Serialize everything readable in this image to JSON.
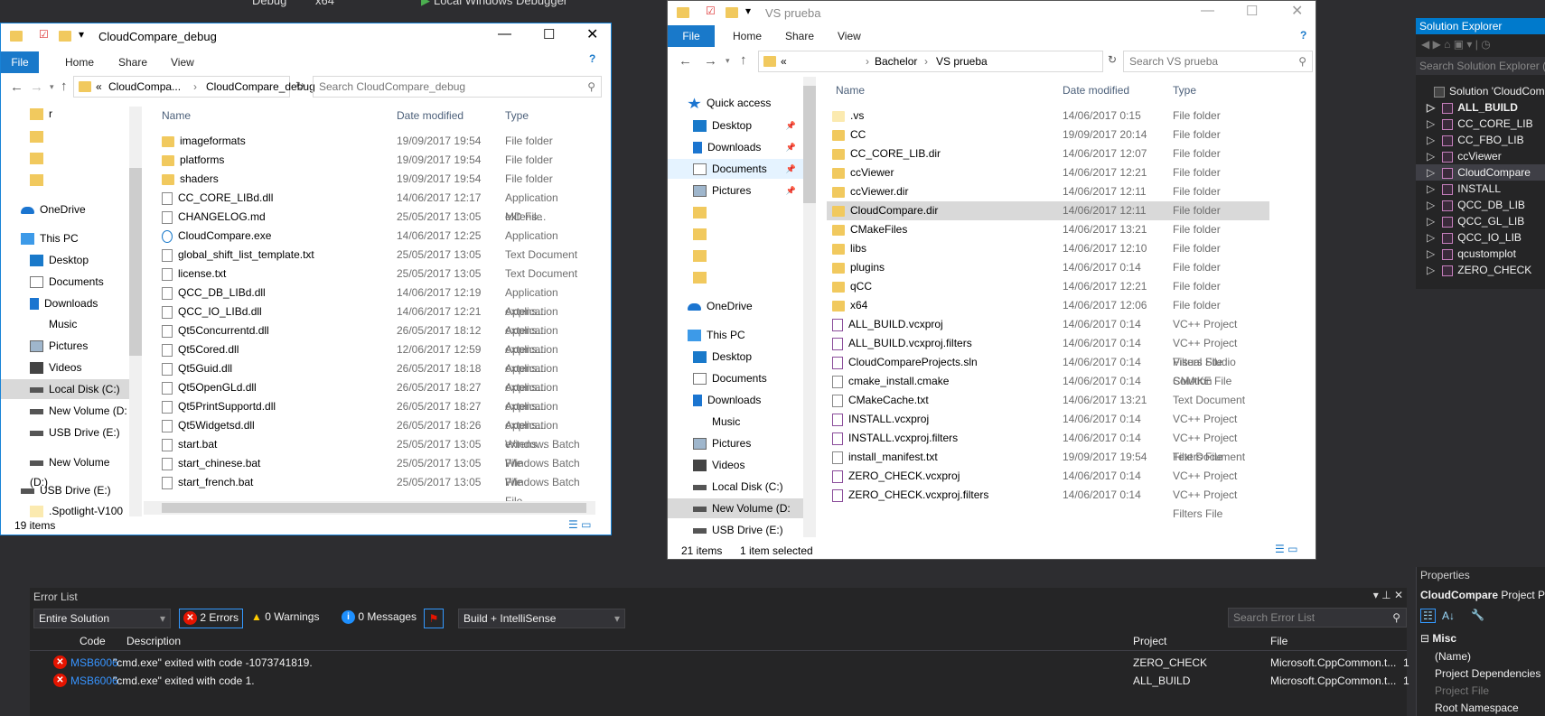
{
  "vs_toolbar": {
    "config": "Debug",
    "platform": "x64",
    "debugger": "Local Windows Debugger"
  },
  "left_window": {
    "title": "CloudCompare_debug",
    "ribbon": [
      "File",
      "Home",
      "Share",
      "View"
    ],
    "address": [
      "«",
      "CloudCompa...",
      "›",
      "CloudCompare_debug"
    ],
    "search_placeholder": "Search CloudCompare_debug",
    "columns": [
      "Name",
      "Date modified",
      "Type"
    ],
    "sidebar": [
      {
        "label": "r",
        "icon": "folder"
      },
      {
        "label": "",
        "icon": "folder"
      },
      {
        "label": "",
        "icon": "folder"
      },
      {
        "label": "",
        "icon": "folder"
      },
      {
        "label": "OneDrive",
        "icon": "onedrive"
      },
      {
        "label": "This PC",
        "icon": "pc"
      },
      {
        "label": "Desktop",
        "icon": "desktop"
      },
      {
        "label": "Documents",
        "icon": "documents"
      },
      {
        "label": "Downloads",
        "icon": "downloads"
      },
      {
        "label": "Music",
        "icon": "music"
      },
      {
        "label": "Pictures",
        "icon": "pictures"
      },
      {
        "label": "Videos",
        "icon": "videos"
      },
      {
        "label": "Local Disk (C:)",
        "icon": "drive",
        "selected": true
      },
      {
        "label": "New Volume (D:",
        "icon": "drive"
      },
      {
        "label": "USB Drive (E:)",
        "icon": "drive"
      },
      {
        "label": "New Volume (D:)",
        "icon": "drive"
      },
      {
        "label": "USB Drive (E:)",
        "icon": "drive"
      },
      {
        "label": ".Spotlight-V100",
        "icon": "folder-light"
      }
    ],
    "files": [
      {
        "name": "imageformats",
        "date": "19/09/2017 19:54",
        "type": "File folder",
        "icon": "folder"
      },
      {
        "name": "platforms",
        "date": "19/09/2017 19:54",
        "type": "File folder",
        "icon": "folder"
      },
      {
        "name": "shaders",
        "date": "19/09/2017 19:54",
        "type": "File folder",
        "icon": "folder"
      },
      {
        "name": "CC_CORE_LIBd.dll",
        "date": "14/06/2017 12:17",
        "type": "Application extens...",
        "icon": "dll"
      },
      {
        "name": "CHANGELOG.md",
        "date": "25/05/2017 13:05",
        "type": "MD File",
        "icon": "file"
      },
      {
        "name": "CloudCompare.exe",
        "date": "14/06/2017 12:25",
        "type": "Application",
        "icon": "exe"
      },
      {
        "name": "global_shift_list_template.txt",
        "date": "25/05/2017 13:05",
        "type": "Text Document",
        "icon": "file"
      },
      {
        "name": "license.txt",
        "date": "25/05/2017 13:05",
        "type": "Text Document",
        "icon": "file"
      },
      {
        "name": "QCC_DB_LIBd.dll",
        "date": "14/06/2017 12:19",
        "type": "Application extens...",
        "icon": "dll"
      },
      {
        "name": "QCC_IO_LIBd.dll",
        "date": "14/06/2017 12:21",
        "type": "Application extens...",
        "icon": "dll"
      },
      {
        "name": "Qt5Concurrentd.dll",
        "date": "26/05/2017 18:12",
        "type": "Application extens...",
        "icon": "dll"
      },
      {
        "name": "Qt5Cored.dll",
        "date": "12/06/2017 12:59",
        "type": "Application extens...",
        "icon": "dll"
      },
      {
        "name": "Qt5Guid.dll",
        "date": "26/05/2017 18:18",
        "type": "Application extens...",
        "icon": "dll"
      },
      {
        "name": "Qt5OpenGLd.dll",
        "date": "26/05/2017 18:27",
        "type": "Application extens...",
        "icon": "dll"
      },
      {
        "name": "Qt5PrintSupportd.dll",
        "date": "26/05/2017 18:27",
        "type": "Application extens...",
        "icon": "dll"
      },
      {
        "name": "Qt5Widgetsd.dll",
        "date": "26/05/2017 18:26",
        "type": "Application extens...",
        "icon": "dll"
      },
      {
        "name": "start.bat",
        "date": "25/05/2017 13:05",
        "type": "Windows Batch File",
        "icon": "bat"
      },
      {
        "name": "start_chinese.bat",
        "date": "25/05/2017 13:05",
        "type": "Windows Batch File",
        "icon": "bat"
      },
      {
        "name": "start_french.bat",
        "date": "25/05/2017 13:05",
        "type": "Windows Batch File",
        "icon": "bat"
      }
    ],
    "status": "19 items"
  },
  "right_window": {
    "title": "VS prueba",
    "ribbon": [
      "File",
      "Home",
      "Share",
      "View"
    ],
    "address": [
      "«",
      "›",
      "Bachelor",
      "›",
      "VS prueba"
    ],
    "search_placeholder": "Search VS prueba",
    "columns": [
      "Name",
      "Date modified",
      "Type"
    ],
    "sidebar": [
      {
        "label": "Quick access",
        "icon": "star"
      },
      {
        "label": "Desktop",
        "icon": "desktop",
        "pin": true
      },
      {
        "label": "Downloads",
        "icon": "downloads",
        "pin": true
      },
      {
        "label": "Documents",
        "icon": "documents",
        "pin": true,
        "hover": true
      },
      {
        "label": "Pictures",
        "icon": "pictures",
        "pin": true
      },
      {
        "label": "",
        "icon": "folder"
      },
      {
        "label": "",
        "icon": "folder"
      },
      {
        "label": "",
        "icon": "folder"
      },
      {
        "label": "",
        "icon": "folder"
      },
      {
        "label": "OneDrive",
        "icon": "onedrive"
      },
      {
        "label": "This PC",
        "icon": "pc"
      },
      {
        "label": "Desktop",
        "icon": "desktop"
      },
      {
        "label": "Documents",
        "icon": "documents"
      },
      {
        "label": "Downloads",
        "icon": "downloads"
      },
      {
        "label": "Music",
        "icon": "music"
      },
      {
        "label": "Pictures",
        "icon": "pictures"
      },
      {
        "label": "Videos",
        "icon": "videos"
      },
      {
        "label": "Local Disk (C:)",
        "icon": "drive"
      },
      {
        "label": "New Volume (D:",
        "icon": "drive",
        "selected": true
      },
      {
        "label": "USB Drive (E:)",
        "icon": "drive"
      }
    ],
    "files": [
      {
        "name": ".vs",
        "date": "14/06/2017 0:15",
        "type": "File folder",
        "icon": "folder-light"
      },
      {
        "name": "CC",
        "date": "19/09/2017 20:14",
        "type": "File folder",
        "icon": "folder"
      },
      {
        "name": "CC_CORE_LIB.dir",
        "date": "14/06/2017 12:07",
        "type": "File folder",
        "icon": "folder"
      },
      {
        "name": "ccViewer",
        "date": "14/06/2017 12:21",
        "type": "File folder",
        "icon": "folder"
      },
      {
        "name": "ccViewer.dir",
        "date": "14/06/2017 12:11",
        "type": "File folder",
        "icon": "folder"
      },
      {
        "name": "CloudCompare.dir",
        "date": "14/06/2017 12:11",
        "type": "File folder",
        "icon": "folder",
        "selected": true
      },
      {
        "name": "CMakeFiles",
        "date": "14/06/2017 13:21",
        "type": "File folder",
        "icon": "folder"
      },
      {
        "name": "libs",
        "date": "14/06/2017 12:10",
        "type": "File folder",
        "icon": "folder"
      },
      {
        "name": "plugins",
        "date": "14/06/2017 0:14",
        "type": "File folder",
        "icon": "folder"
      },
      {
        "name": "qCC",
        "date": "14/06/2017 12:21",
        "type": "File folder",
        "icon": "folder"
      },
      {
        "name": "x64",
        "date": "14/06/2017 12:06",
        "type": "File folder",
        "icon": "folder"
      },
      {
        "name": "ALL_BUILD.vcxproj",
        "date": "14/06/2017 0:14",
        "type": "VC++ Project",
        "icon": "vcxproj"
      },
      {
        "name": "ALL_BUILD.vcxproj.filters",
        "date": "14/06/2017 0:14",
        "type": "VC++ Project Filters File",
        "icon": "filters"
      },
      {
        "name": "CloudCompareProjects.sln",
        "date": "14/06/2017 0:14",
        "type": "Visual Studio Solution",
        "icon": "sln"
      },
      {
        "name": "cmake_install.cmake",
        "date": "14/06/2017 0:14",
        "type": "CMAKE File",
        "icon": "file"
      },
      {
        "name": "CMakeCache.txt",
        "date": "14/06/2017 13:21",
        "type": "Text Document",
        "icon": "file"
      },
      {
        "name": "INSTALL.vcxproj",
        "date": "14/06/2017 0:14",
        "type": "VC++ Project",
        "icon": "vcxproj"
      },
      {
        "name": "INSTALL.vcxproj.filters",
        "date": "14/06/2017 0:14",
        "type": "VC++ Project Filters File",
        "icon": "filters"
      },
      {
        "name": "install_manifest.txt",
        "date": "19/09/2017 19:54",
        "type": "Text Document",
        "icon": "file"
      },
      {
        "name": "ZERO_CHECK.vcxproj",
        "date": "14/06/2017 0:14",
        "type": "VC++ Project",
        "icon": "vcxproj"
      },
      {
        "name": "ZERO_CHECK.vcxproj.filters",
        "date": "14/06/2017 0:14",
        "type": "VC++ Project Filters File",
        "icon": "filters"
      }
    ],
    "status": "21 items",
    "status_selected": "1 item selected"
  },
  "solution_explorer": {
    "title": "Solution Explorer",
    "search_placeholder": "Search Solution Explorer (C",
    "solution": "Solution 'CloudCompa",
    "projects": [
      {
        "name": "ALL_BUILD",
        "bold": true
      },
      {
        "name": "CC_CORE_LIB"
      },
      {
        "name": "CC_FBO_LIB"
      },
      {
        "name": "ccViewer"
      },
      {
        "name": "CloudCompare",
        "selected": true
      },
      {
        "name": "INSTALL"
      },
      {
        "name": "QCC_DB_LIB"
      },
      {
        "name": "QCC_GL_LIB"
      },
      {
        "name": "QCC_IO_LIB"
      },
      {
        "name": "qcustomplot"
      },
      {
        "name": "ZERO_CHECK"
      }
    ]
  },
  "error_list": {
    "title": "Error List",
    "scope": "Entire Solution",
    "errors": "2 Errors",
    "warnings": "0 Warnings",
    "messages": "0 Messages",
    "source": "Build + IntelliSense",
    "search_placeholder": "Search Error List",
    "columns": [
      "Code",
      "Description",
      "Project",
      "File"
    ],
    "rows": [
      {
        "code": "MSB6006",
        "description": "\"cmd.exe\" exited with code -1073741819.",
        "project": "ZERO_CHECK",
        "file": "Microsoft.CppCommon.t...",
        "line": "1"
      },
      {
        "code": "MSB6006",
        "description": "\"cmd.exe\" exited with code 1.",
        "project": "ALL_BUILD",
        "file": "Microsoft.CppCommon.t...",
        "line": "1"
      }
    ]
  },
  "properties": {
    "title": "Properties",
    "object": "CloudCompare",
    "object_type": "Project Pr",
    "category": "Misc",
    "items": [
      {
        "name": "(Name)"
      },
      {
        "name": "Project Dependencies"
      },
      {
        "name": "Project File",
        "disabled": true
      },
      {
        "name": "Root Namespace"
      }
    ]
  },
  "colors": {
    "accent": "#1979ca",
    "selection": "#d9d9d9",
    "error": "#e51400",
    "vs_link": "#3794ff",
    "vs_bg": "#2d2d30"
  }
}
